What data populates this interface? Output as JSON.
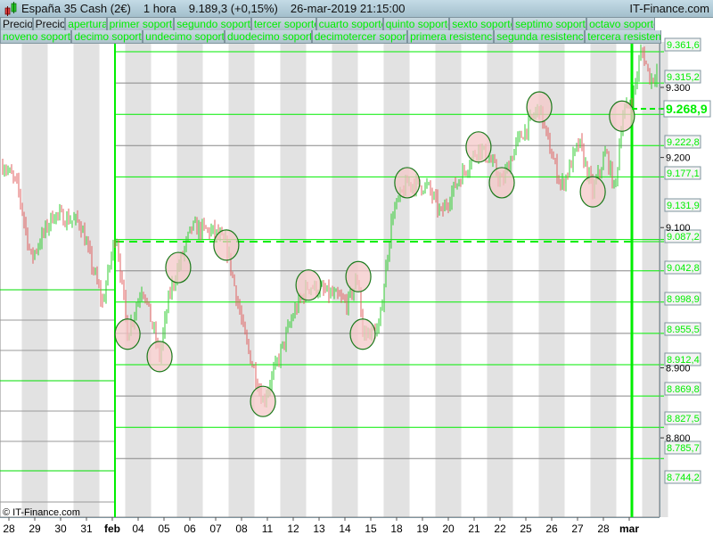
{
  "header": {
    "instrument": "España 35 Cash (2€)",
    "timeframe": "1 hora",
    "price": "9.189,3 (+0,15%)",
    "datetime": "26-mar-2019 21:15:00",
    "brand": "IT-Finance.com"
  },
  "tabs_row1": [
    "Precio",
    "Precio",
    "apertura",
    "primer soporte",
    "segundo soporte",
    "tercer soporte",
    "cuarto soporte",
    "quinto soporte",
    "sexto soporte",
    "septimo soporte",
    "octavo soporte"
  ],
  "tabs_row2": [
    "noveno soporte",
    "decimo soporte",
    "undecimo soporte",
    "duodecimo soporte",
    "decimotercer soporte",
    "primera resistencia",
    "segunda resistencia",
    "tercera resistenc"
  ],
  "copyright": "© IT-Finance.com",
  "colors": {
    "level": "#00ee00",
    "up": "#33cc33",
    "down": "#e06060",
    "circle_fill": "#f4c8c8",
    "circle_stroke": "#1a7a1a"
  },
  "chart_data": {
    "type": "candlestick",
    "title": "España 35 Cash (2€) 1 hora",
    "x_ticks": [
      "28",
      "29",
      "30",
      "31",
      "feb",
      "04",
      "05",
      "06",
      "07",
      "08",
      "11",
      "12",
      "13",
      "14",
      "15",
      "18",
      "19",
      "20",
      "21",
      "22",
      "25",
      "26",
      "27",
      "28",
      "mar"
    ],
    "y_ticks": [
      "9.300",
      "9.200",
      "9.100",
      "8.900",
      "8.800"
    ],
    "y_tick_values": [
      9300,
      9200,
      9100,
      8900,
      8800
    ],
    "ylim": [
      8690,
      9420
    ],
    "current_price": "9.268,9",
    "levels": [
      {
        "value": 9361.6,
        "label": "9.361,6"
      },
      {
        "value": 9315.2,
        "label": "9.315,2"
      },
      {
        "value": 9222.8,
        "label": "9.222,8"
      },
      {
        "value": 9177.1,
        "label": "9.177,1"
      },
      {
        "value": 9131.9,
        "label": "9.131,9"
      },
      {
        "value": 9087.2,
        "label": "9.087,2",
        "dashed": true
      },
      {
        "value": 9042.8,
        "label": "9.042,8"
      },
      {
        "value": 8998.9,
        "label": "8.998,9"
      },
      {
        "value": 8955.5,
        "label": "8.955,5"
      },
      {
        "value": 8912.4,
        "label": "8.912,4"
      },
      {
        "value": 8869.8,
        "label": "8.869,8"
      },
      {
        "value": 8827.5,
        "label": "8.827,5"
      },
      {
        "value": 8785.7,
        "label": "8.785,7"
      },
      {
        "value": 8744.2,
        "label": "8.744,2"
      }
    ],
    "price_path": [
      [
        -0.17,
        9189
      ],
      [
        0.34,
        9158
      ],
      [
        0.86,
        9056
      ],
      [
        1.72,
        9119
      ],
      [
        2.76,
        9107
      ],
      [
        3.62,
        8992
      ],
      [
        4.14,
        9094
      ],
      [
        4.59,
        8948
      ],
      [
        5.17,
        9018
      ],
      [
        5.83,
        8916
      ],
      [
        6.21,
        9005
      ],
      [
        6.55,
        9043
      ],
      [
        7.07,
        9100
      ],
      [
        7.93,
        9094
      ],
      [
        8.41,
        9075
      ],
      [
        8.79,
        9005
      ],
      [
        9.14,
        8941
      ],
      [
        9.83,
        8852
      ],
      [
        10.34,
        8903
      ],
      [
        11.03,
        8979
      ],
      [
        11.59,
        9018
      ],
      [
        12.41,
        9005
      ],
      [
        13.1,
        8992
      ],
      [
        13.52,
        9030
      ],
      [
        13.69,
        8948
      ],
      [
        14.31,
        8954
      ],
      [
        14.83,
        9119
      ],
      [
        15.41,
        9164
      ],
      [
        16.21,
        9158
      ],
      [
        16.72,
        9119
      ],
      [
        17.24,
        9158
      ],
      [
        18.17,
        9215
      ],
      [
        18.62,
        9196
      ],
      [
        19.07,
        9164
      ],
      [
        19.66,
        9221
      ],
      [
        20.52,
        9272
      ],
      [
        20.86,
        9221
      ],
      [
        21.38,
        9158
      ],
      [
        22.07,
        9221
      ],
      [
        22.59,
        9151
      ],
      [
        23.1,
        9208
      ],
      [
        23.45,
        9151
      ],
      [
        23.72,
        9259
      ],
      [
        24.14,
        9285
      ],
      [
        24.48,
        9355
      ],
      [
        24.83,
        9310
      ],
      [
        25.17,
        9329
      ]
    ],
    "marked_pivots": [
      [
        4.59,
        8948
      ],
      [
        5.83,
        8916
      ],
      [
        6.55,
        9043
      ],
      [
        8.41,
        9075
      ],
      [
        9.83,
        8852
      ],
      [
        11.59,
        9018
      ],
      [
        13.52,
        9030
      ],
      [
        13.69,
        8948
      ],
      [
        15.41,
        9164
      ],
      [
        18.17,
        9215
      ],
      [
        19.07,
        9164
      ],
      [
        20.52,
        9272
      ],
      [
        22.59,
        9151
      ],
      [
        23.72,
        9259
      ]
    ]
  }
}
